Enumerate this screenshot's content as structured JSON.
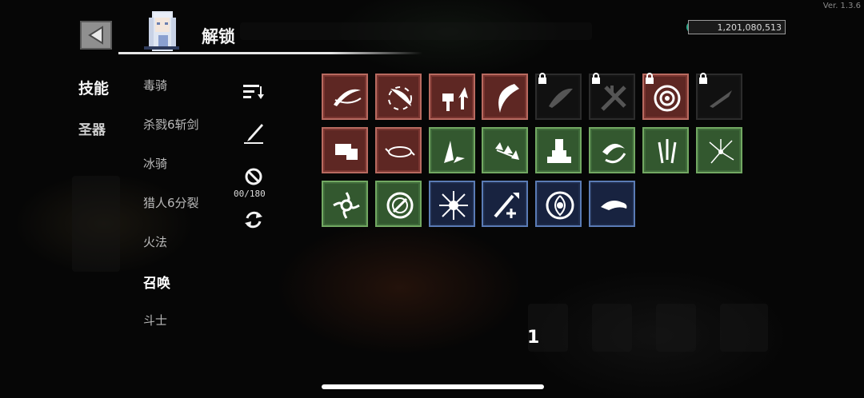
{
  "version": "Ver. 1.3.6",
  "header": {
    "title": "解锁",
    "currency": "1,201,080,513"
  },
  "categories": [
    {
      "label": "技能",
      "active": true
    },
    {
      "label": "圣器",
      "active": false
    }
  ],
  "builds": [
    {
      "label": "毒骑",
      "active": false
    },
    {
      "label": "杀戮6斩剑",
      "active": false
    },
    {
      "label": "冰骑",
      "active": false
    },
    {
      "label": "猎人6分裂",
      "active": false
    },
    {
      "label": "火法",
      "active": false
    },
    {
      "label": "召唤",
      "active": true
    },
    {
      "label": "斗士",
      "active": false
    }
  ],
  "tools": {
    "counter": "00/180"
  },
  "skills": [
    {
      "icon": "slash-arc-icon",
      "tier": "red",
      "locked": false
    },
    {
      "icon": "blade-spin-icon",
      "tier": "red",
      "locked": false
    },
    {
      "icon": "hammer-upgrade-icon",
      "tier": "red",
      "locked": false
    },
    {
      "icon": "crescent-strike-icon",
      "tier": "red",
      "locked": false
    },
    {
      "icon": "shadow-feather-icon",
      "tier": "locked",
      "locked": true
    },
    {
      "icon": "shattered-cross-icon",
      "tier": "locked",
      "locked": true
    },
    {
      "icon": "target-orb-icon",
      "tier": "red",
      "locked": true
    },
    {
      "icon": "shadow-quill-icon",
      "tier": "locked",
      "locked": true
    },
    {
      "icon": "fist-punch-icon",
      "tier": "red",
      "locked": false
    },
    {
      "icon": "whirlwind-icon",
      "tier": "red",
      "locked": false
    },
    {
      "icon": "ground-spike-icon",
      "tier": "green",
      "locked": false
    },
    {
      "icon": "chain-stars-icon",
      "tier": "green",
      "locked": false
    },
    {
      "icon": "summon-statue-icon",
      "tier": "green",
      "locked": false
    },
    {
      "icon": "claw-swirl-icon",
      "tier": "green",
      "locked": false
    },
    {
      "icon": "daggers-rain-icon",
      "tier": "green",
      "locked": false
    },
    {
      "icon": "crack-burst-icon",
      "tier": "green",
      "locked": false
    },
    {
      "icon": "shuriken-icon",
      "tier": "green",
      "locked": false
    },
    {
      "icon": "rune-circle-icon",
      "tier": "green",
      "locked": false
    },
    {
      "icon": "frost-burst-icon",
      "tier": "blue",
      "locked": false
    },
    {
      "icon": "sword-boost-icon",
      "tier": "blue",
      "locked": false
    },
    {
      "icon": "vortex-ring-icon",
      "tier": "blue",
      "locked": false
    },
    {
      "icon": "dash-wave-icon",
      "tier": "blue",
      "locked": false
    }
  ],
  "page_number": "1"
}
